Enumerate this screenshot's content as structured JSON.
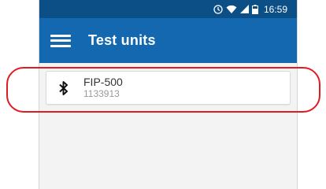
{
  "status_bar": {
    "time": "16:59",
    "icons": [
      "alarm-icon",
      "wifi-icon",
      "signal-icon",
      "battery-icon"
    ]
  },
  "app_bar": {
    "title": "Test units",
    "menu_icon": "hamburger-menu-icon"
  },
  "units": [
    {
      "name": "FIP-500",
      "serial": "1133913",
      "icon": "bluetooth-icon"
    }
  ],
  "colors": {
    "status_bar": "#0c4e86",
    "app_bar": "#1468b0",
    "highlight": "#e01b24"
  }
}
